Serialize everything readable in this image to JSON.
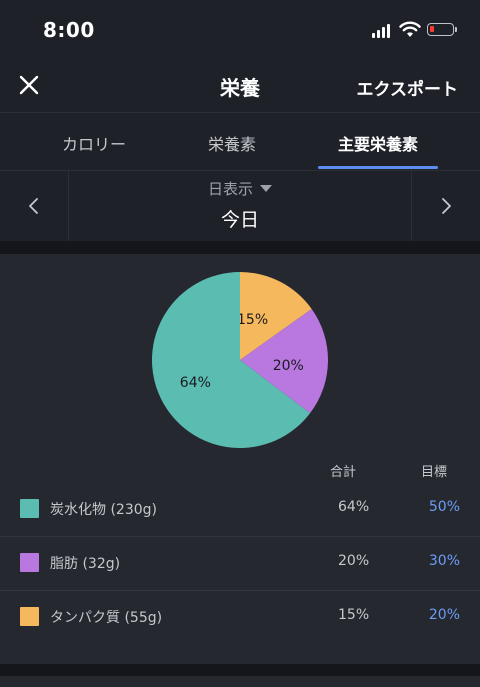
{
  "status_bar": {
    "time": "8:00",
    "battery_color": "#ff3b30"
  },
  "nav": {
    "close_icon": "close-icon",
    "title": "栄養",
    "export_label": "エクスポート"
  },
  "tabs": [
    {
      "label": "カロリー",
      "active": false
    },
    {
      "label": "栄養素",
      "active": false
    },
    {
      "label": "主要栄養素",
      "active": true
    }
  ],
  "date_nav": {
    "view_mode": "日表示",
    "date": "今日",
    "prev_icon": "chevron-left-icon",
    "next_icon": "chevron-right-icon"
  },
  "chart_data": {
    "type": "pie",
    "slices": [
      {
        "label": "15%",
        "value": 15,
        "color": "#f6b85c"
      },
      {
        "label": "20%",
        "value": 20,
        "color": "#b978e0"
      },
      {
        "label": "64%",
        "value": 64,
        "color": "#5bbcb1"
      }
    ]
  },
  "table": {
    "headers": {
      "total": "合計",
      "goal": "目標"
    },
    "rows": [
      {
        "label": "炭水化物 (230g)",
        "percent": "64%",
        "goal": "50%",
        "color": "#5bbcb1"
      },
      {
        "label": "脂肪 (32g)",
        "percent": "20%",
        "goal": "30%",
        "color": "#b978e0"
      },
      {
        "label": "タンパク質 (55g)",
        "percent": "15%",
        "goal": "20%",
        "color": "#f6b85c"
      }
    ]
  },
  "colors": {
    "accent": "#5e8ef1",
    "goal_text": "#6b9cf4",
    "background": "#1f2129",
    "card": "#262830"
  }
}
